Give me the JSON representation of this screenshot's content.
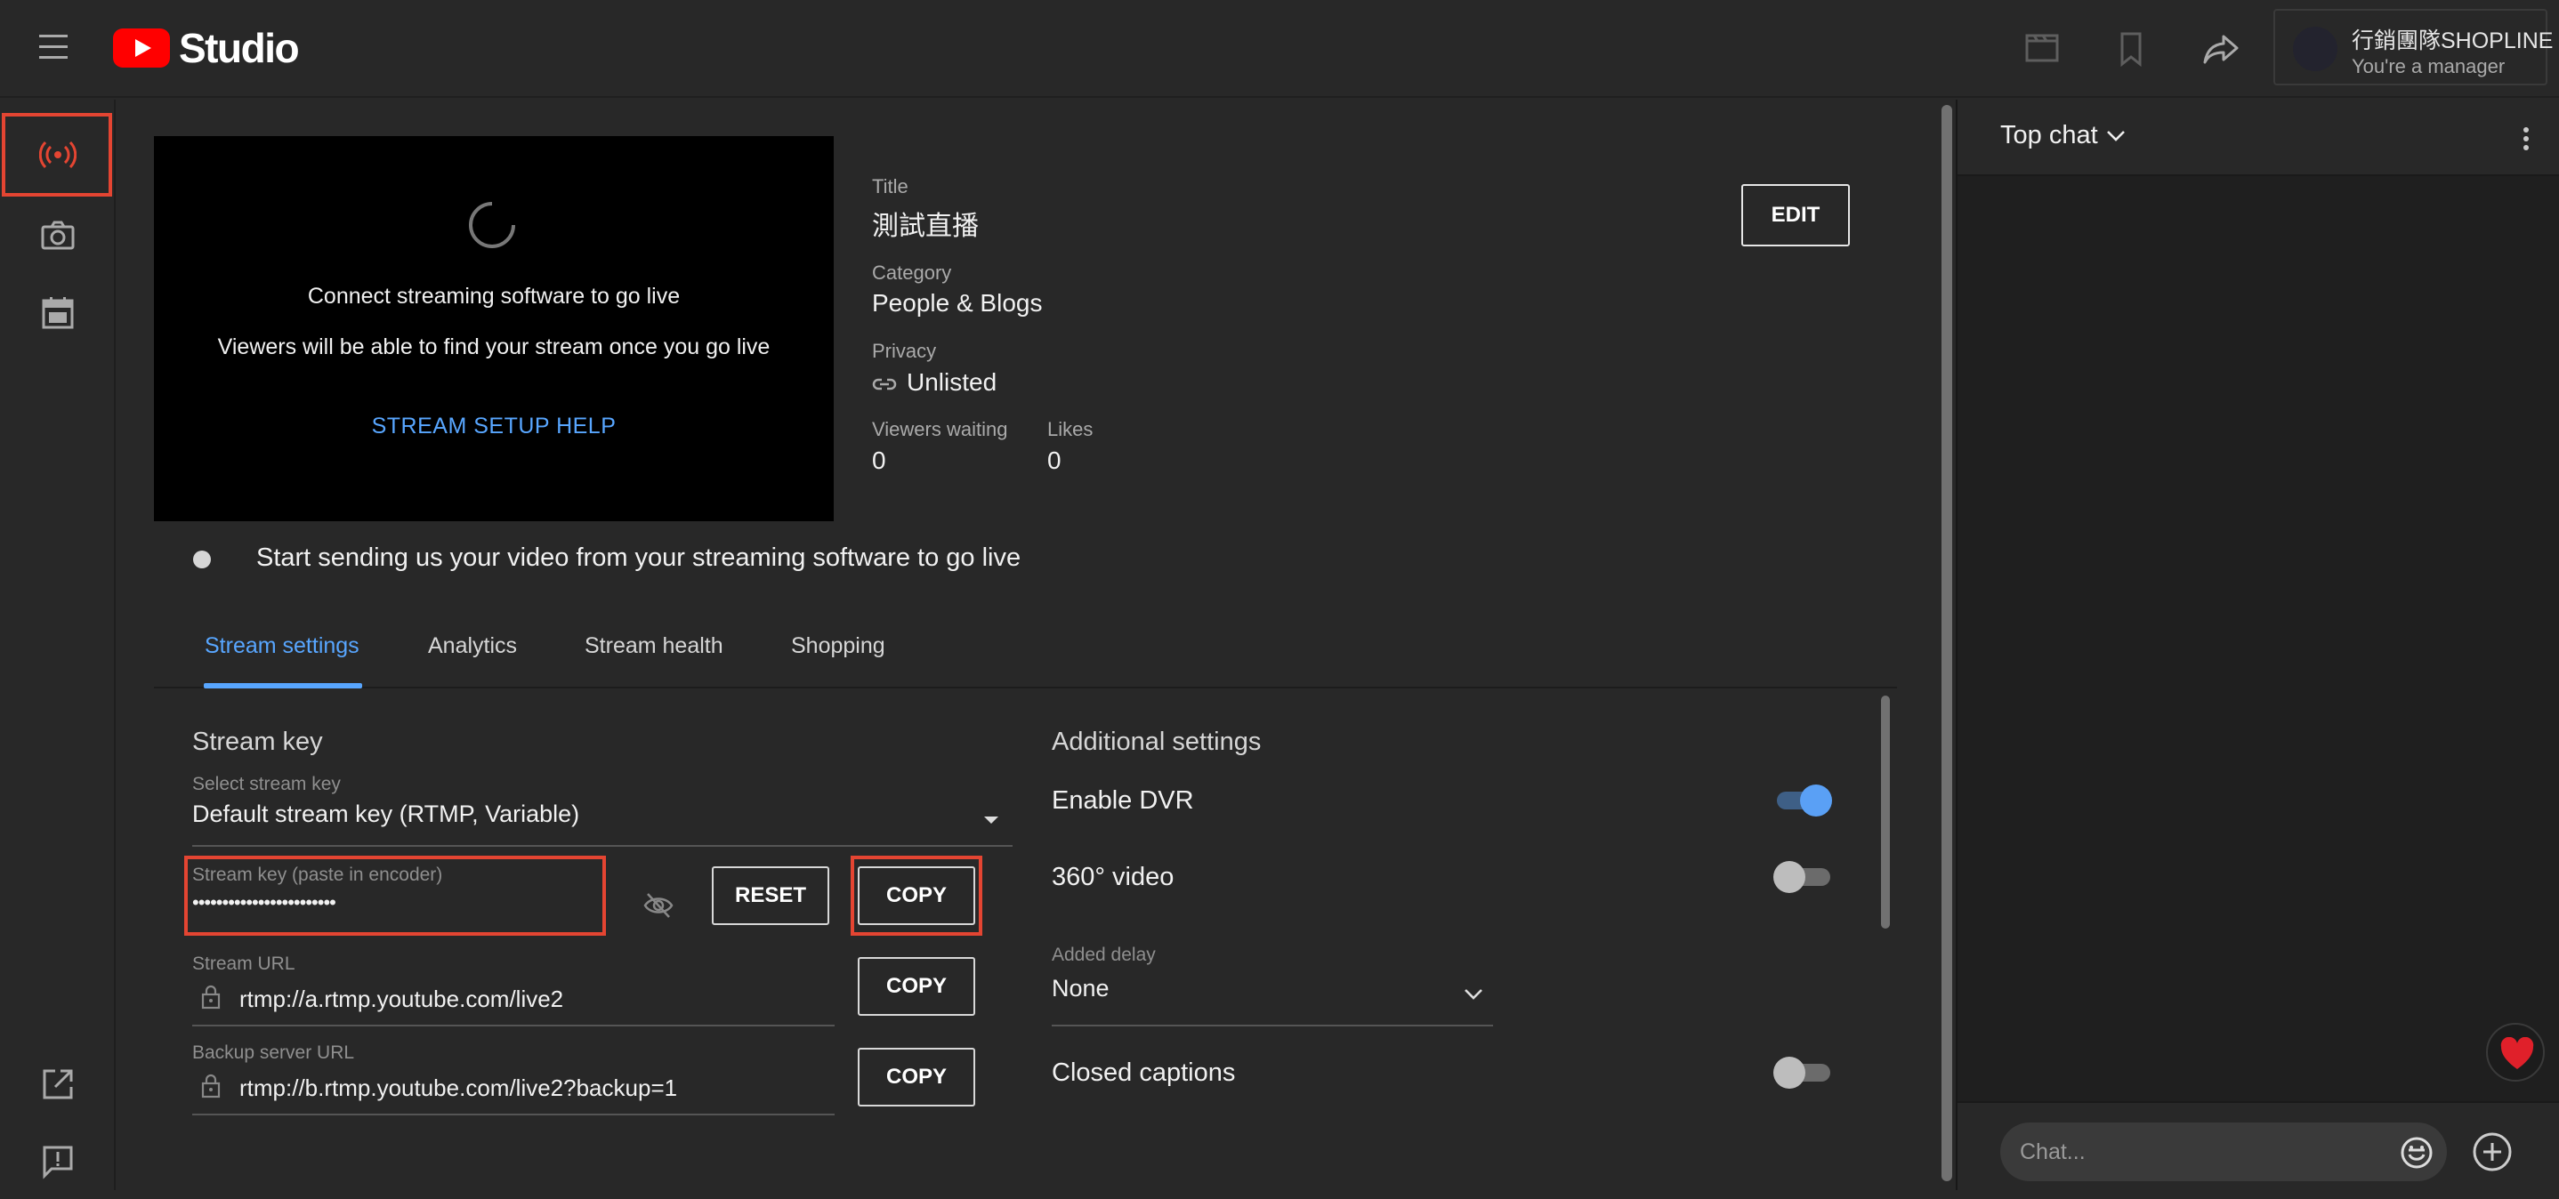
{
  "header": {
    "logo_text": "Studio",
    "channel_name": "行銷團隊SHOPLINE",
    "channel_role": "You're a manager"
  },
  "preview": {
    "line1": "Connect streaming software to go live",
    "line2": "Viewers will be able to find your stream once you go live",
    "help_link": "STREAM SETUP HELP"
  },
  "details": {
    "title_label": "Title",
    "title_value": "測試直播",
    "category_label": "Category",
    "category_value": "People & Blogs",
    "privacy_label": "Privacy",
    "privacy_value": "Unlisted",
    "viewers_label": "Viewers waiting",
    "viewers_value": "0",
    "likes_label": "Likes",
    "likes_value": "0",
    "edit_button": "EDIT"
  },
  "status": {
    "message": "Start sending us your video from your streaming software to go live"
  },
  "tabs": [
    {
      "label": "Stream settings",
      "active": true
    },
    {
      "label": "Analytics",
      "active": false
    },
    {
      "label": "Stream health",
      "active": false
    },
    {
      "label": "Shopping",
      "active": false
    }
  ],
  "stream_key": {
    "section_title": "Stream key",
    "select_label": "Select stream key",
    "select_value": "Default stream key (RTMP, Variable)",
    "key_label": "Stream key (paste in encoder)",
    "key_value": "••••••••••••••••••••••••",
    "reset_button": "RESET",
    "copy_button": "COPY",
    "url_label": "Stream URL",
    "url_value": "rtmp://a.rtmp.youtube.com/live2",
    "backup_label": "Backup server URL",
    "backup_value": "rtmp://b.rtmp.youtube.com/live2?backup=1"
  },
  "additional": {
    "section_title": "Additional settings",
    "dvr_label": "Enable DVR",
    "dvr_on": true,
    "video360_label": "360° video",
    "video360_on": false,
    "delay_label": "Added delay",
    "delay_value": "None",
    "captions_label": "Closed captions",
    "captions_on": false
  },
  "chat": {
    "title": "Top chat",
    "placeholder": "Chat..."
  },
  "colors": {
    "accent_blue": "#58a6ff",
    "highlight_red": "#e44532",
    "youtube_red": "#ff0000"
  }
}
